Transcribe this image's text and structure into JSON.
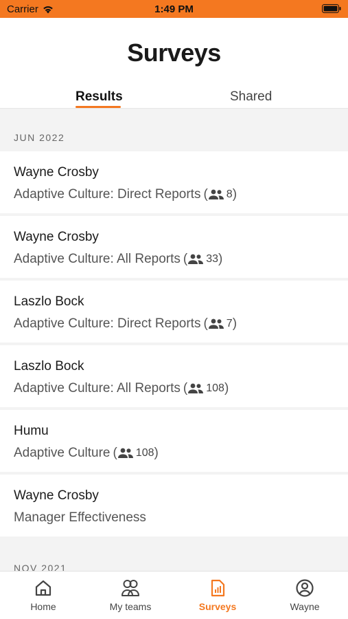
{
  "status_bar": {
    "carrier": "Carrier",
    "time": "1:49 PM"
  },
  "header": {
    "title": "Surveys",
    "tabs": [
      {
        "label": "Results",
        "active": true
      },
      {
        "label": "Shared",
        "active": false
      }
    ]
  },
  "sections": [
    {
      "date": "JUN 2022",
      "items": [
        {
          "name": "Wayne Crosby",
          "survey": "Adaptive Culture: Direct Reports",
          "open": "(",
          "count": "8",
          "close": ")"
        },
        {
          "name": "Wayne Crosby",
          "survey": "Adaptive Culture: All Reports",
          "open": "(",
          "count": "33",
          "close": ")"
        },
        {
          "name": "Laszlo Bock",
          "survey": "Adaptive Culture: Direct Reports",
          "open": "(",
          "count": "7",
          "close": ")"
        },
        {
          "name": "Laszlo Bock",
          "survey": "Adaptive Culture: All Reports",
          "open": "(",
          "count": "108",
          "close": ")"
        },
        {
          "name": "Humu",
          "survey": "Adaptive Culture",
          "open": "(",
          "count": "108",
          "close": ")"
        },
        {
          "name": "Wayne Crosby",
          "survey": "Manager Effectiveness"
        }
      ]
    },
    {
      "date": "NOV 2021",
      "items": []
    }
  ],
  "tabbar": [
    {
      "label": "Home",
      "icon": "home-icon",
      "active": false
    },
    {
      "label": "My teams",
      "icon": "team-icon",
      "active": false
    },
    {
      "label": "Surveys",
      "icon": "survey-report-icon",
      "active": true
    },
    {
      "label": "Wayne",
      "icon": "profile-icon",
      "active": false
    }
  ],
  "colors": {
    "accent": "#f47820",
    "background": "#f3f3f3"
  }
}
